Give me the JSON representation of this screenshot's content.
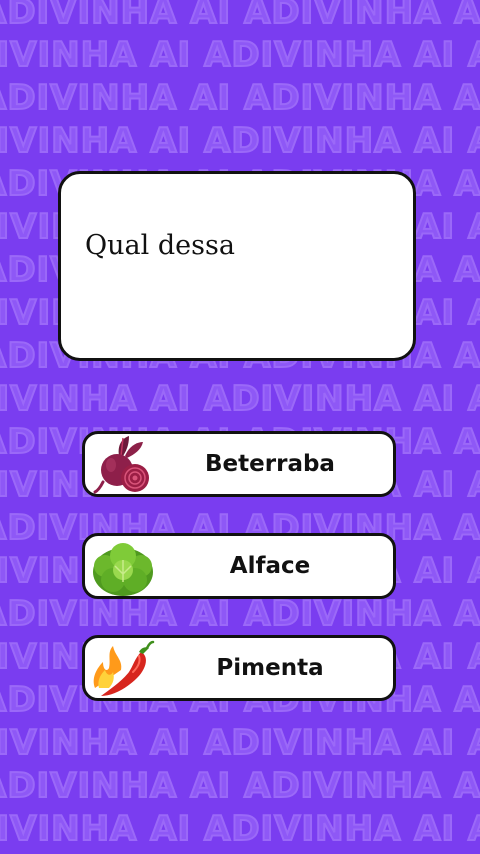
{
  "background": {
    "pattern_text": "ADIVINHA AI ADIVINHA AI ADIVINHA AI ADIVINHA AI",
    "color": "#7a3df0"
  },
  "question": {
    "text": "Qual dessa"
  },
  "options": [
    {
      "label": "Beterraba",
      "icon": "beet-icon"
    },
    {
      "label": "Alface",
      "icon": "lettuce-icon"
    },
    {
      "label": "Pimenta",
      "icon": "chili-pepper-icon"
    }
  ]
}
